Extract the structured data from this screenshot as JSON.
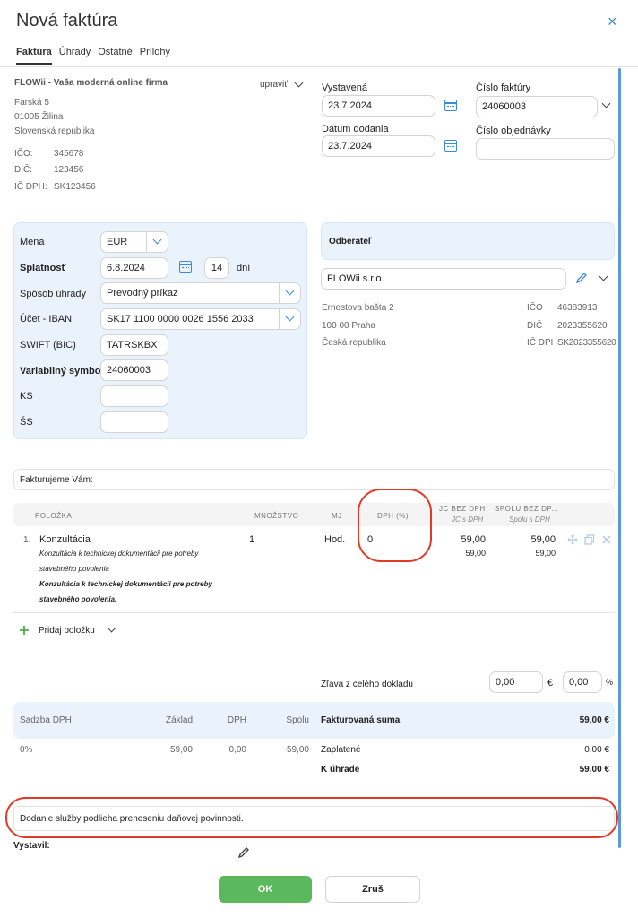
{
  "title": "Nová faktúra",
  "close": "×",
  "tabs": [
    "Faktúra",
    "Úhrady",
    "Ostatné",
    "Prílohy"
  ],
  "supplier": {
    "name": "FLOWii - Vaša moderná online firma",
    "edit": "upraviť",
    "street": "Farská 5",
    "city": "01005 Žilina",
    "country": "Slovenská republika",
    "ico_label": "IČO:",
    "ico": "345678",
    "dic_label": "DIČ:",
    "dic": "123456",
    "icdph_label": "IČ DPH:",
    "icdph": "SK123456"
  },
  "dates": {
    "issued_label": "Vystavená",
    "issued": "23.7.2024",
    "delivery_label": "Dátum dodania",
    "delivery": "23.7.2024",
    "number_label": "Číslo faktúry",
    "number": "24060003",
    "order_label": "Číslo objednávky",
    "order": ""
  },
  "payment": {
    "currency_label": "Mena",
    "currency": "EUR",
    "due_label": "Splatnosť",
    "due": "6.8.2024",
    "due_days": "14",
    "days_unit": "dní",
    "method_label": "Spôsob úhrady",
    "method": "Prevodný príkaz",
    "iban_label": "Účet - IBAN",
    "iban": "SK17 1100 0000 0026 1556 2033",
    "swift_label": "SWIFT (BIC)",
    "swift": "TATRSKBX",
    "vs_label": "Variabilný symbol",
    "vs": "24060003",
    "ks_label": "KS",
    "ss_label": "ŠS"
  },
  "customer": {
    "heading": "Odberateľ",
    "name": "FLOWii s.r.o.",
    "street": "Ernestova bašta 2",
    "city": "100 00 Praha",
    "country": "Česká republika",
    "ico_label": "IČO",
    "ico": "46383913",
    "dic_label": "DIČ",
    "dic": "2023355620",
    "icdph_label": "IČ DPH",
    "icdph": "SK2023355620"
  },
  "intro": "Fakturujeme Vám:",
  "table": {
    "h_item": "POLOŽKA",
    "h_qty": "MNOŽSTVO",
    "h_unit": "MJ",
    "h_vat": "DPH (%)",
    "h_unit_price": "JC BEZ DPH",
    "h_unit_price_vat": "JC s DPH",
    "h_total": "SPOLU BEZ DP...",
    "h_total_vat": "Spolu s DPH",
    "rows": [
      {
        "no": "1.",
        "name": "Konzultácia",
        "desc1": "Konzultácia k technickej dokumentácii pre potreby",
        "desc2": "stavebného povolenia",
        "desc3": "Konzultácia k technickej dokumentácii pre potreby",
        "desc4": "stavebného povolenia.",
        "qty": "1",
        "unit": "Hod.",
        "vat": "0",
        "unit_price": "59,00",
        "unit_price_vat": "59,00",
        "total": "59,00",
        "total_vat": "59,00"
      }
    ],
    "add_item": "Pridaj položku"
  },
  "discount": {
    "label": "Zľava z celého dokladu",
    "value": "0,00",
    "currency": "€",
    "percent": "0,00",
    "percent_sign": "%"
  },
  "vat_summary": {
    "h_rate": "Sadzba DPH",
    "h_base": "Základ",
    "h_vat": "DPH",
    "h_total": "Spolu",
    "rate": "0%",
    "base": "59,00",
    "vat": "0,00",
    "total": "59,00"
  },
  "totals": {
    "invoiced_label": "Fakturovaná suma",
    "invoiced": "59,00 €",
    "paid_label": "Zaplatené",
    "paid": "0,00 €",
    "due_label": "K úhrade",
    "due": "59,00 €"
  },
  "note": "Dodanie služby podlieha preneseniu daňovej povinnosti.",
  "issuer_label": "Vystavil:",
  "buttons": {
    "ok": "OK",
    "cancel": "Zruš"
  },
  "colors": {
    "accent": "#3a8bd8",
    "ok": "#5cb85c",
    "annotation": "#e13a25",
    "panel": "#eaf3fc"
  }
}
